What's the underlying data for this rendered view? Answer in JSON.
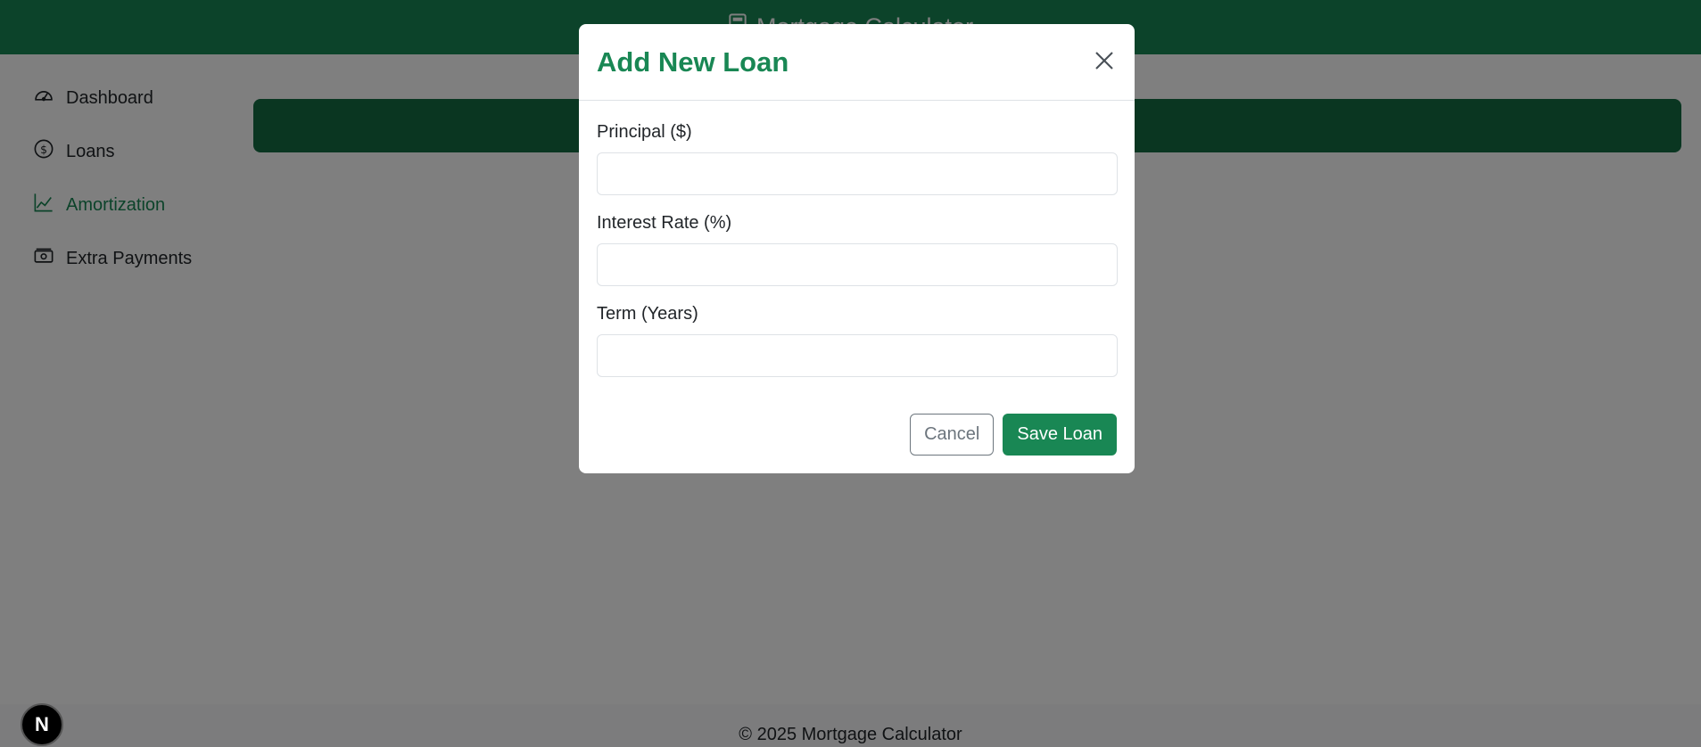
{
  "header": {
    "title": "Mortgage Calculator",
    "icon": "calculator-icon"
  },
  "sidebar": {
    "items": [
      {
        "label": "Dashboard",
        "icon": "speedometer-icon",
        "active": false
      },
      {
        "label": "Loans",
        "icon": "dollar-circle-icon",
        "active": false
      },
      {
        "label": "Amortization",
        "icon": "line-chart-icon",
        "active": true
      },
      {
        "label": "Extra Payments",
        "icon": "cash-icon",
        "active": false
      }
    ]
  },
  "modal": {
    "title": "Add New Loan",
    "fields": [
      {
        "label": "Principal ($)",
        "value": "",
        "placeholder": ""
      },
      {
        "label": "Interest Rate (%)",
        "value": "",
        "placeholder": ""
      },
      {
        "label": "Term (Years)",
        "value": "",
        "placeholder": ""
      }
    ],
    "cancel_label": "Cancel",
    "save_label": "Save Loan"
  },
  "footer": {
    "text": "© 2025 Mortgage Calculator"
  },
  "badge": {
    "letter": "N"
  },
  "colors": {
    "primary": "#198754",
    "primary_dark": "#146c43",
    "secondary": "#6c757d",
    "backdrop": "rgba(0,0,0,0.5)"
  }
}
